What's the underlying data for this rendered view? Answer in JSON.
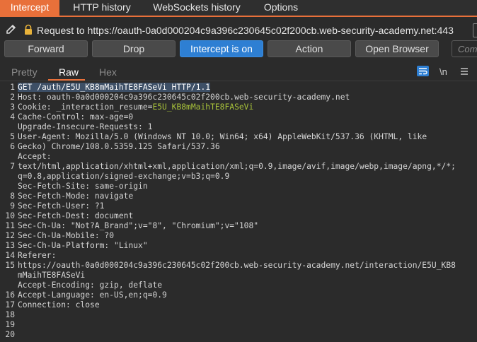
{
  "tabs": [
    {
      "label": "Intercept",
      "active": true
    },
    {
      "label": "HTTP history",
      "active": false
    },
    {
      "label": "WebSockets history",
      "active": false
    },
    {
      "label": "Options",
      "active": false
    }
  ],
  "request_bar": {
    "text": "Request to https://oauth-0a0d000204c9a396c230645c02f200cb.web-security-academy.net:443"
  },
  "actions": {
    "forward": "Forward",
    "drop": "Drop",
    "intercept": "Intercept is on",
    "action": "Action",
    "open_browser": "Open Browser",
    "comment_placeholder": "Comm"
  },
  "view_tabs": {
    "pretty": "Pretty",
    "raw": "Raw",
    "hex": "Hex",
    "newline_toggle": "\\n"
  },
  "colors": {
    "accent": "#e8703a",
    "primary_button": "#2e7fd3",
    "cookie_value": "#a8c23a",
    "selection": "#3d4f66"
  },
  "editor": {
    "line_numbers": [
      "1",
      "2",
      "3",
      "4",
      "",
      "5",
      "6",
      "",
      "7",
      "",
      "",
      "8",
      "9",
      "10",
      "11",
      "12",
      "13",
      "14",
      "15",
      "",
      "",
      "16",
      "17",
      "18",
      "19",
      "20"
    ],
    "lines": [
      {
        "text": "GET /auth/E5U_KB8mMaihTE8FASeVi HTTP/1.1"
      },
      {
        "key": "Host:",
        "value": " oauth-0a0d000204c9a396c230645c02f200cb.web-security-academy.net"
      },
      {
        "key": "Cookie:",
        "value": " _interaction_resume",
        "eq": "=",
        "cookie": "E5U_KB8mMaihTE8FASeVi"
      },
      {
        "key": "Cache-Control:",
        "value": " max-age=0"
      },
      {
        "key": "Upgrade-Insecure-Requests:",
        "value": " 1"
      },
      {
        "key": "User-Agent:",
        "value": " Mozilla/5.0 (Windows NT 10.0; Win64; x64) AppleWebKit/537.36 (KHTML, like"
      },
      {
        "text": "Gecko) Chrome/108.0.5359.125 Safari/537.36"
      },
      {
        "key": "Accept:",
        "value": ""
      },
      {
        "text": "text/html,application/xhtml+xml,application/xml;q=0.9,image/avif,image/webp,image/apng,*/*;"
      },
      {
        "text": "q=0.8,application/signed-exchange;v=b3;q=0.9"
      },
      {
        "key": "Sec-Fetch-Site:",
        "value": " same-origin"
      },
      {
        "key": "Sec-Fetch-Mode:",
        "value": " navigate"
      },
      {
        "key": "Sec-Fetch-User:",
        "value": " ?1"
      },
      {
        "key": "Sec-Fetch-Dest:",
        "value": " document"
      },
      {
        "key": "Sec-Ch-Ua:",
        "value": " \"Not?A_Brand\";v=\"8\", \"Chromium\";v=\"108\""
      },
      {
        "key": "Sec-Ch-Ua-Mobile:",
        "value": " ?0"
      },
      {
        "key": "Sec-Ch-Ua-Platform:",
        "value": " \"Linux\""
      },
      {
        "key": "Referer:",
        "value": ""
      },
      {
        "text": "https://oauth-0a0d000204c9a396c230645c02f200cb.web-security-academy.net/interaction/E5U_KB8"
      },
      {
        "text": "mMaihTE8FASeVi"
      },
      {
        "key": "Accept-Encoding:",
        "value": " gzip, deflate"
      },
      {
        "key": "Accept-Language:",
        "value": " en-US,en;q=0.9"
      },
      {
        "key": "Connection:",
        "value": " close"
      },
      {
        "text": ""
      },
      {
        "text": ""
      },
      {
        "text": ""
      }
    ]
  }
}
